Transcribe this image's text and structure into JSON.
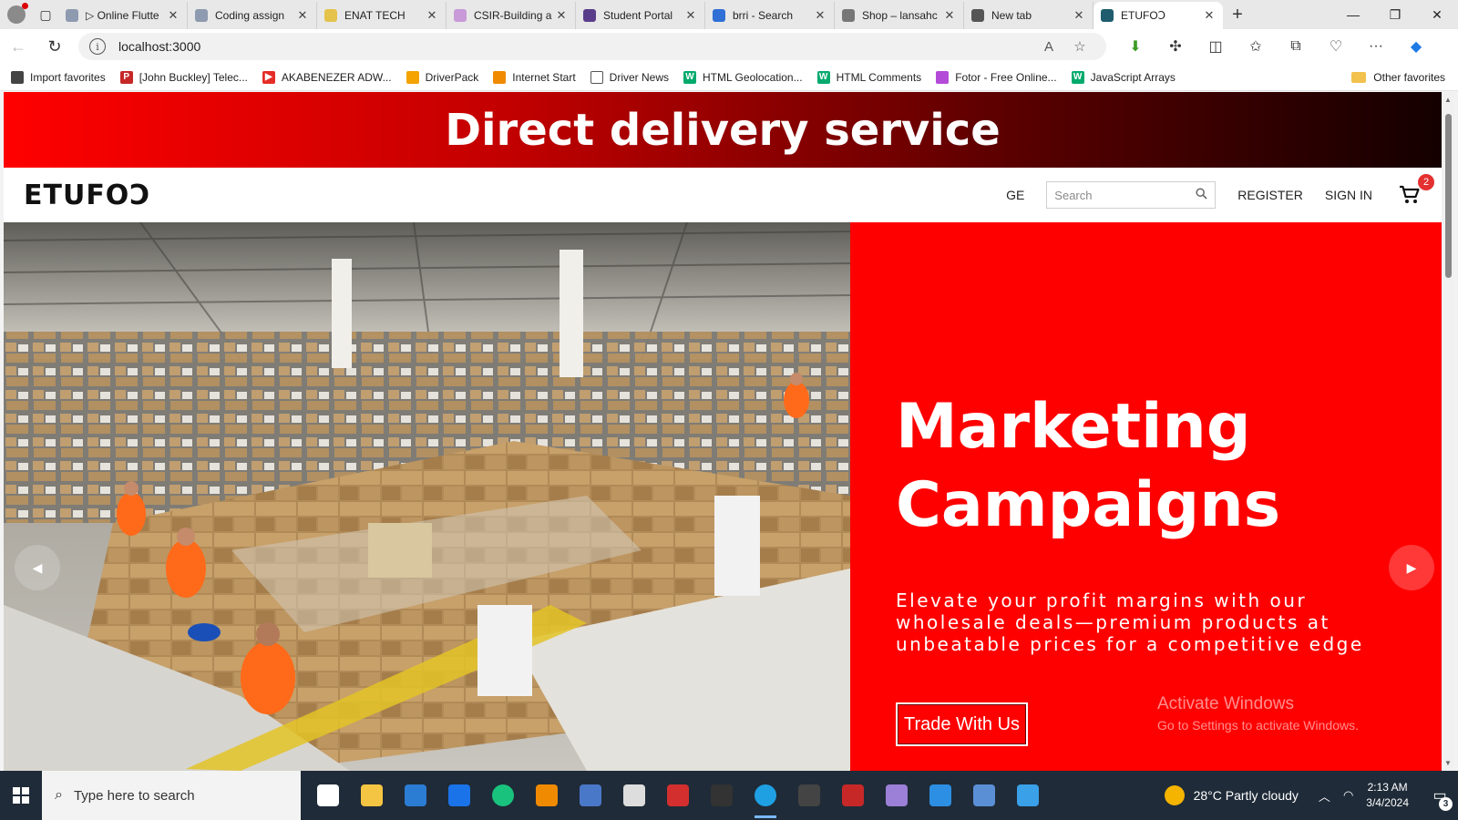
{
  "browser": {
    "tabs": [
      {
        "label": "▷ Online Flutte",
        "color": "#8d9ab0"
      },
      {
        "label": "Coding assign",
        "color": "#8d9ab0"
      },
      {
        "label": "ENAT TECH",
        "color": "#e5c24a"
      },
      {
        "label": "CSIR-Building a",
        "color": "#c89ad8"
      },
      {
        "label": "Student Portal",
        "color": "#5a3d8a"
      },
      {
        "label": "brri - Search",
        "color": "#2f6fd6"
      },
      {
        "label": "Shop – lansahc",
        "color": "#777777"
      },
      {
        "label": "New tab",
        "color": "#555555"
      },
      {
        "label": "ETUFOↃ",
        "color": "#1f5c6e"
      }
    ],
    "url": "localhost:3000",
    "favorites": [
      {
        "label": "Import favorites",
        "color": "#444444",
        "glyph": ""
      },
      {
        "label": "[John Buckley] Telec...",
        "color": "#c62828",
        "glyph": "P"
      },
      {
        "label": "AKABENEZER ADW...",
        "color": "#e52d27",
        "glyph": "▶"
      },
      {
        "label": "DriverPack",
        "color": "#f4a300",
        "glyph": ""
      },
      {
        "label": "Internet Start",
        "color": "#f08a00",
        "glyph": ""
      },
      {
        "label": "Driver News",
        "color": "#ffffff",
        "glyph": ""
      },
      {
        "label": "HTML Geolocation...",
        "color": "#04aa6d",
        "glyph": "W"
      },
      {
        "label": "HTML Comments",
        "color": "#04aa6d",
        "glyph": "W"
      },
      {
        "label": "Fotor - Free Online...",
        "color": "#b44ad8",
        "glyph": ""
      },
      {
        "label": "JavaScript Arrays",
        "color": "#04aa6d",
        "glyph": "W"
      }
    ],
    "other_favorites": "Other favorites"
  },
  "page": {
    "promo": "Direct delivery service",
    "logo": "ETUFOↃ",
    "nav": {
      "lang": "GE",
      "search_placeholder": "Search",
      "register": "REGISTER",
      "signin": "SIGN IN",
      "cart_count": "2"
    },
    "hero": {
      "title_line1": "Marketing",
      "title_line2": "Campaigns",
      "subtitle": "Elevate your profit margins with our wholesale deals—premium products at unbeatable prices for a competitive edge",
      "button": "Trade With Us",
      "bg_color": "#ff0000"
    },
    "watermark": {
      "line1": "Activate Windows",
      "line2": "Go to Settings to activate Windows."
    }
  },
  "taskbar": {
    "search": "Type here to search",
    "apps": [
      {
        "name": "task-view",
        "color": "#ffffff"
      },
      {
        "name": "file-explorer",
        "color": "#f4c542"
      },
      {
        "name": "mail",
        "color": "#2b7cd3"
      },
      {
        "name": "app-w",
        "color": "#1a73e8"
      },
      {
        "name": "app-circle",
        "color": "#19c37d"
      },
      {
        "name": "vlc",
        "color": "#f08a00"
      },
      {
        "name": "app-arrow",
        "color": "#4a78c8"
      },
      {
        "name": "bible",
        "color": "#dddddd"
      },
      {
        "name": "app-red",
        "color": "#d32f2f"
      },
      {
        "name": "app-dark",
        "color": "#333333"
      },
      {
        "name": "edge",
        "color": "#1fa0e3"
      },
      {
        "name": "app-v",
        "color": "#444444"
      },
      {
        "name": "mcafee",
        "color": "#c62828"
      },
      {
        "name": "app-c",
        "color": "#9c7fd6"
      },
      {
        "name": "vscode",
        "color": "#2d8fe3"
      },
      {
        "name": "remote-desktop",
        "color": "#5a8fd6"
      },
      {
        "name": "paint",
        "color": "#3aa0e8"
      }
    ],
    "weather": "28°C  Partly cloudy",
    "time": "2:13 AM",
    "date": "3/4/2024",
    "notifications": "3"
  }
}
